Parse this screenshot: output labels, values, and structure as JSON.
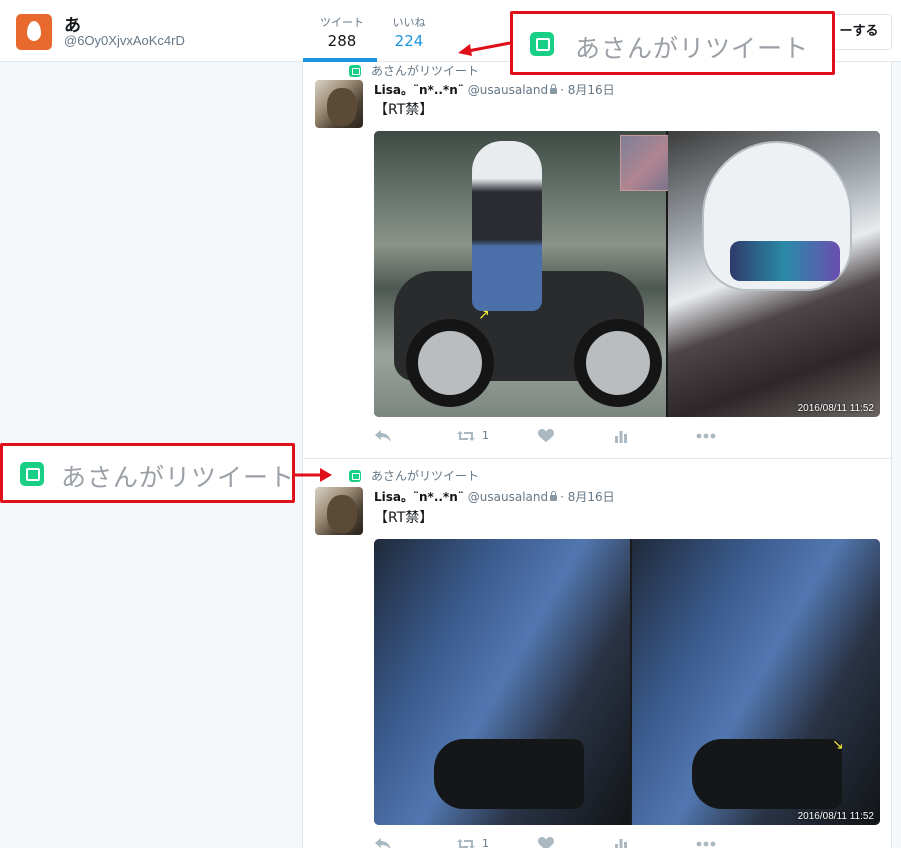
{
  "profile": {
    "name": "あ",
    "handle": "@6Oy0XjvxAoKc4rD"
  },
  "stats": {
    "tweets_label": "ツイート",
    "tweets_value": "288",
    "likes_label": "いいね",
    "likes_value": "224"
  },
  "follow_button": "ーする",
  "callouts": {
    "top_text": "あさんがリツイート",
    "left_text": "あさんがリツイート"
  },
  "tweets": [
    {
      "retweeted_by": "あさんがリツイート",
      "display_name": "Lisa。¨n*..*n¨",
      "username": "@usausaland",
      "date": "· 8月16日",
      "text": "【RT禁】",
      "image_timestamp": "2016/08/11 11:52",
      "retweet_count": "1"
    },
    {
      "retweeted_by": "あさんがリツイート",
      "display_name": "Lisa。¨n*..*n¨",
      "username": "@usausaland",
      "date": "· 8月16日",
      "text": "【RT禁】",
      "image_timestamp": "2016/08/11 11:52",
      "retweet_count": "1"
    }
  ],
  "colors": {
    "accent": "#1b95e0",
    "retweet_green": "#19cf86",
    "callout_red": "#e0101a",
    "egg_orange": "#e8692d"
  }
}
